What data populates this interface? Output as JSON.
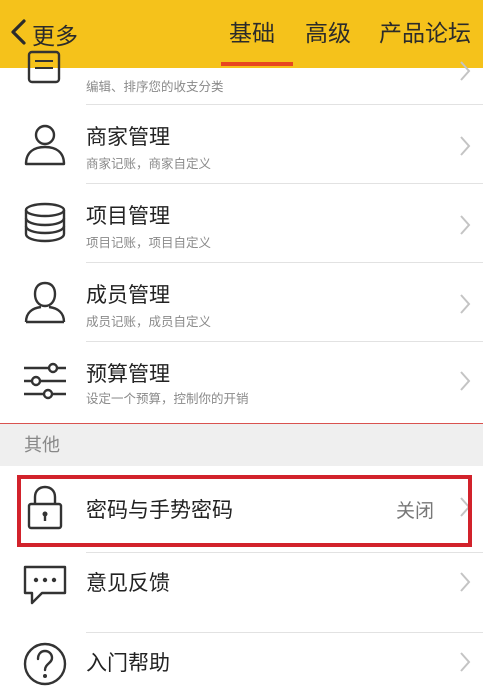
{
  "header": {
    "back_label": "更多",
    "tabs": [
      {
        "label": "基础",
        "active": true
      },
      {
        "label": "高级",
        "active": false
      },
      {
        "label": "产品论坛",
        "active": false
      }
    ],
    "bar_color": "#f5c21b",
    "accent_color": "#e8461f"
  },
  "basic_items": [
    {
      "title": "",
      "subtitle": "编辑、排序您的收支分类",
      "icon": "category-list-icon"
    },
    {
      "title": "商家管理",
      "subtitle": "商家记账，商家自定义",
      "icon": "merchant-person-icon"
    },
    {
      "title": "项目管理",
      "subtitle": "项目记账，项目自定义",
      "icon": "project-stack-icon"
    },
    {
      "title": "成员管理",
      "subtitle": "成员记账，成员自定义",
      "icon": "member-person-icon"
    },
    {
      "title": "预算管理",
      "subtitle": "设定一个预算，控制你的开销",
      "icon": "budget-sliders-icon"
    }
  ],
  "other_section": {
    "header": "其他",
    "items": [
      {
        "title": "密码与手势密码",
        "value": "关闭",
        "icon": "lock-icon",
        "highlighted": true
      },
      {
        "title": "意见反馈",
        "icon": "feedback-chat-icon"
      },
      {
        "title": "入门帮助",
        "icon": "help-question-icon"
      }
    ]
  },
  "highlight_color": "#d2222b"
}
